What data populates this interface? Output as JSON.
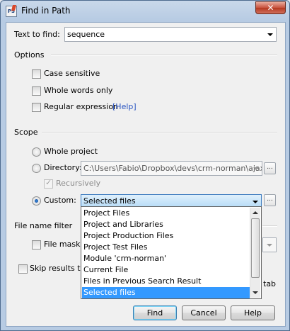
{
  "window": {
    "title": "Find in Path",
    "close_glyph": "✕",
    "app_icon": "phpstorm-icon"
  },
  "text_to_find": {
    "label": "Text to find:",
    "value": "sequence"
  },
  "options": {
    "title": "Options",
    "case_sensitive": {
      "label": "Case sensitive",
      "checked": false
    },
    "whole_words": {
      "label": "Whole words only",
      "checked": false
    },
    "regex": {
      "label": "Regular expression",
      "checked": false,
      "help_link": "[Help]"
    }
  },
  "scope": {
    "title": "Scope",
    "whole_project": {
      "label": "Whole project",
      "selected": false
    },
    "directory": {
      "label": "Directory:",
      "selected": false,
      "path": "C:\\Users\\Fabio\\Dropbox\\devs\\crm-norman\\ajax",
      "browse": "..."
    },
    "recursively": {
      "label": "Recursively",
      "checked": true,
      "enabled": false
    },
    "custom": {
      "label": "Custom:",
      "selected": true,
      "value": "Selected files",
      "browse": "..."
    }
  },
  "dropdown": {
    "items": [
      "Project Files",
      "Project and Libraries",
      "Project Production Files",
      "Project Test Files",
      "Module 'crm-norman'",
      "Current File",
      "Files in Previous Search Result",
      "Selected files"
    ],
    "selected_index": 7
  },
  "file_filter": {
    "title": "File name filter",
    "label": "File mask(s)",
    "checked": false
  },
  "skip_results": {
    "label": "Skip results tab",
    "tail": "tab"
  },
  "buttons": {
    "find": "Find",
    "cancel": "Cancel",
    "help": "Help"
  },
  "colors": {
    "selection": "#3399ff",
    "link": "#2a55c2",
    "close": "#c8523e"
  }
}
